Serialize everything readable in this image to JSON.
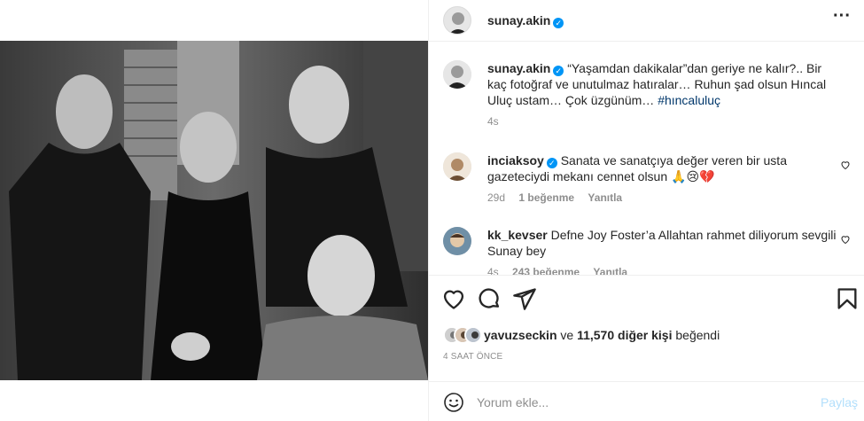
{
  "post": {
    "username": "sunay.akin",
    "verified": true
  },
  "caption": {
    "username": "sunay.akin",
    "text": "“Yaşamdan dakikalar”dan geriye ne kalır?.. Bir kaç fotoğraf ve unutulmaz hatıralar… Ruhun şad olsun Hıncal Uluç ustam… Çok üzgünüm…",
    "hashtag": "#hıncaluluç",
    "time": "4s"
  },
  "comments": [
    {
      "username": "inciaksoy",
      "verified": true,
      "text": "Sanata ve sanatçıya değer veren bir usta gazeteciydi mekanı cennet olsun 🙏😢💔",
      "time": "29d",
      "likes": "1 beğenme",
      "reply": "Yanıtla"
    },
    {
      "username": "kk_kevser",
      "verified": false,
      "text": "Defne Joy Foster’a Allahtan rahmet diliyorum sevgili Sunay bey",
      "time": "4s",
      "likes": "243 beğenme",
      "reply": "Yanıtla"
    }
  ],
  "likes": {
    "first_user": "yavuzseckin",
    "connector": "ve",
    "others": "11,570 diğer kişi",
    "suffix": "beğendi"
  },
  "timestamp": "4 SAAT ÖNCE",
  "add_comment": {
    "placeholder": "Yorum ekle...",
    "post_label": "Paylaş"
  },
  "icons": {
    "more": "more-options-icon",
    "like": "heart-icon",
    "comment": "comment-icon",
    "share": "paper-plane-icon",
    "save": "bookmark-icon",
    "emoji": "emoji-icon"
  },
  "colors": {
    "verified": "#0095f6",
    "link": "#00376b",
    "muted": "#8e8e8e",
    "post_button": "#b2dffc"
  }
}
